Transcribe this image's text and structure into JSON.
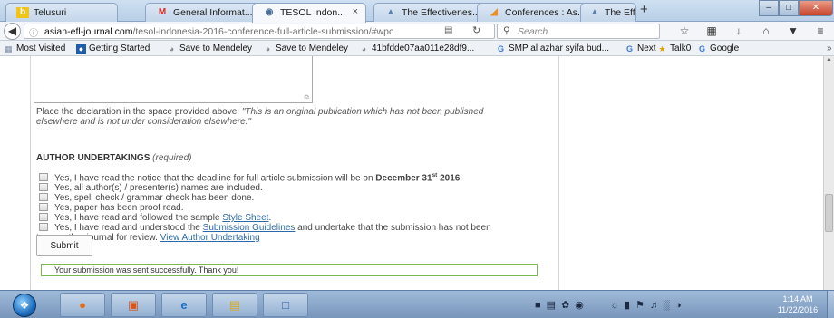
{
  "browser": {
    "tabs": [
      {
        "label": "Telusuri",
        "icon": "bing-icon"
      },
      {
        "label": "General Informat...",
        "icon": "gmail-icon"
      },
      {
        "label": "TESOL Indon...",
        "icon": "page-icon",
        "active": true
      },
      {
        "label": "The Effectivenes...",
        "icon": "scholar-icon"
      },
      {
        "label": "Conferences : As...",
        "icon": "conference-icon"
      },
      {
        "label": "The Effectivenes...",
        "icon": "scholar-icon"
      }
    ],
    "url_host": "asian-efl-journal.com",
    "url_path": "/tesol-indonesia-2016-conference-full-article-submission/#wpc",
    "search_placeholder": "Search",
    "bookmarks": [
      {
        "label": "Most Visited"
      },
      {
        "label": "Getting Started"
      },
      {
        "label": "Save to Mendeley"
      },
      {
        "label": "Save to Mendeley"
      },
      {
        "label": "41bfdde07aa011e28df9..."
      },
      {
        "label": "SMP al azhar syifa bud..."
      },
      {
        "label": "Next"
      },
      {
        "label": "Talk0"
      },
      {
        "label": "Google"
      }
    ]
  },
  "form": {
    "declaration_prefix": "Place the declaration in the space provided above:",
    "declaration_quote_1": "\"This is an original publication which has not been published",
    "declaration_quote_2": "elsewhere and is not under consideration elsewhere.\"",
    "section_title": "AUTHOR UNDERTAKINGS",
    "section_required": "(required)",
    "undertaking_1_text": "Yes, I have read the notice that the deadline for full article submission will be on ",
    "undertaking_1_date": "December 31",
    "undertaking_1_sup": "st",
    "undertaking_1_year": " 2016",
    "undertaking_2": "Yes, all author(s) / presenter(s) names are included.",
    "undertaking_3": "Yes, spell check / grammar check has been done.",
    "undertaking_4": "Yes, paper has been proof read.",
    "undertaking_5_text": "Yes, I have read and followed the sample ",
    "undertaking_5_link": "Style Sheet",
    "undertaking_6_text": "Yes, I have read and understood the ",
    "undertaking_6_link": "Submission Guidelines",
    "undertaking_6_rest": " and undertake that the submission has not been",
    "undertaking_6_line2": "to any other journal for review. ",
    "undertaking_6_link2": "View Author Undertaking",
    "submit_label": "Submit",
    "success_message": "Your submission was sent successfully. Thank you!"
  },
  "taskbar": {
    "time": "1:14 AM",
    "date": "11/22/2016"
  },
  "colors": {
    "success_border": "#78b84e",
    "link": "#2b6aa8",
    "close_button": "#c8442b"
  }
}
